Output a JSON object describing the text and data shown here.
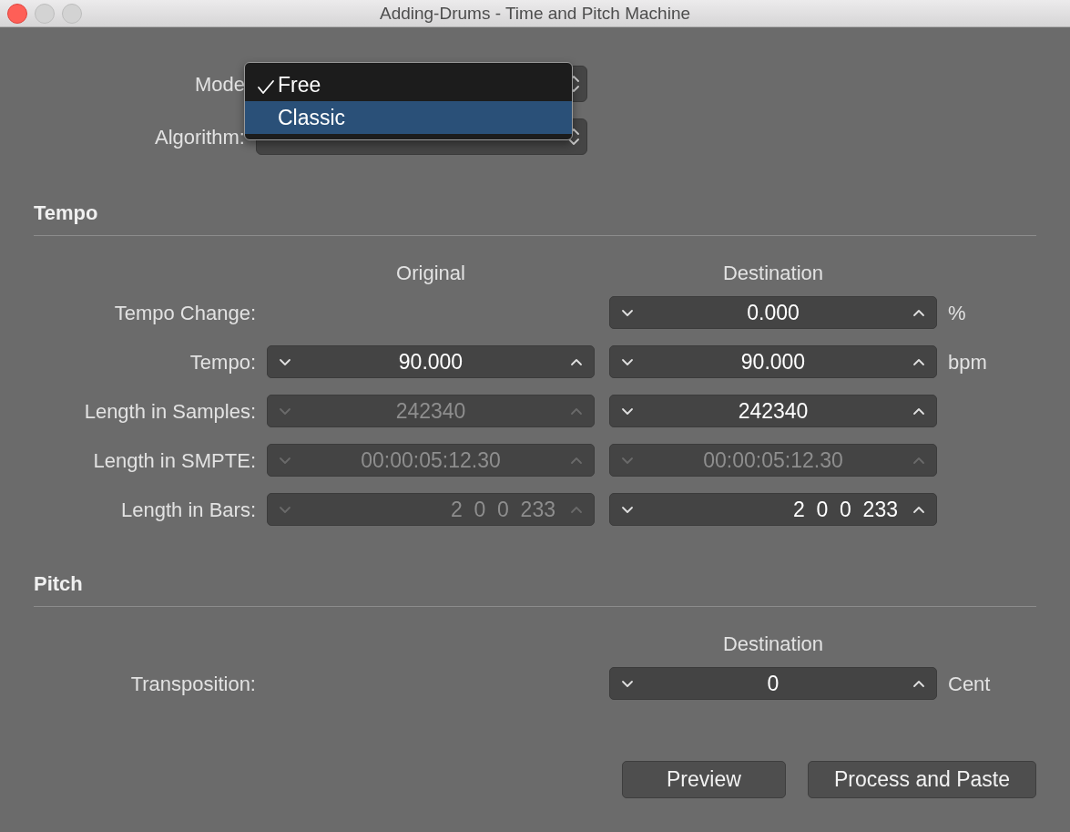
{
  "window": {
    "title": "Adding-Drums - Time and Pitch Machine"
  },
  "mode": {
    "label": "Mode",
    "menu": [
      {
        "label": "Free",
        "checked": true,
        "selected": false
      },
      {
        "label": "Classic",
        "checked": false,
        "selected": true
      }
    ]
  },
  "algorithm": {
    "label": "Algorithm:"
  },
  "sections": [
    {
      "title": "Tempo",
      "columns": {
        "original": "Original",
        "destination": "Destination"
      },
      "rows": [
        {
          "label": "Tempo Change:",
          "kind": "number",
          "destination": {
            "value": "0.000",
            "disabled": false
          },
          "unit": "%"
        },
        {
          "label": "Tempo:",
          "kind": "number",
          "original": {
            "value": "90.000",
            "disabled": false
          },
          "destination": {
            "value": "90.000",
            "disabled": false
          },
          "unit": "bpm"
        },
        {
          "label": "Length in Samples:",
          "kind": "number",
          "original": {
            "value": "242340",
            "disabled": true
          },
          "destination": {
            "value": "242340",
            "disabled": false
          }
        },
        {
          "label": "Length in SMPTE:",
          "kind": "number",
          "original": {
            "value": "00:00:05:12.30",
            "disabled": true
          },
          "destination": {
            "value": "00:00:05:12.30",
            "disabled": true
          }
        },
        {
          "label": "Length in Bars:",
          "kind": "position",
          "original": {
            "value": "2  0  0  233",
            "disabled": true
          },
          "destination": {
            "value": "2  0  0  233",
            "disabled": false
          }
        }
      ]
    },
    {
      "title": "Pitch",
      "columns": {
        "destination": "Destination"
      },
      "rows": [
        {
          "label": "Transposition:",
          "kind": "number",
          "destination": {
            "value": "0",
            "disabled": false
          },
          "unit": "Cent"
        }
      ]
    }
  ],
  "buttons": [
    "Preview",
    "Process and Paste"
  ]
}
